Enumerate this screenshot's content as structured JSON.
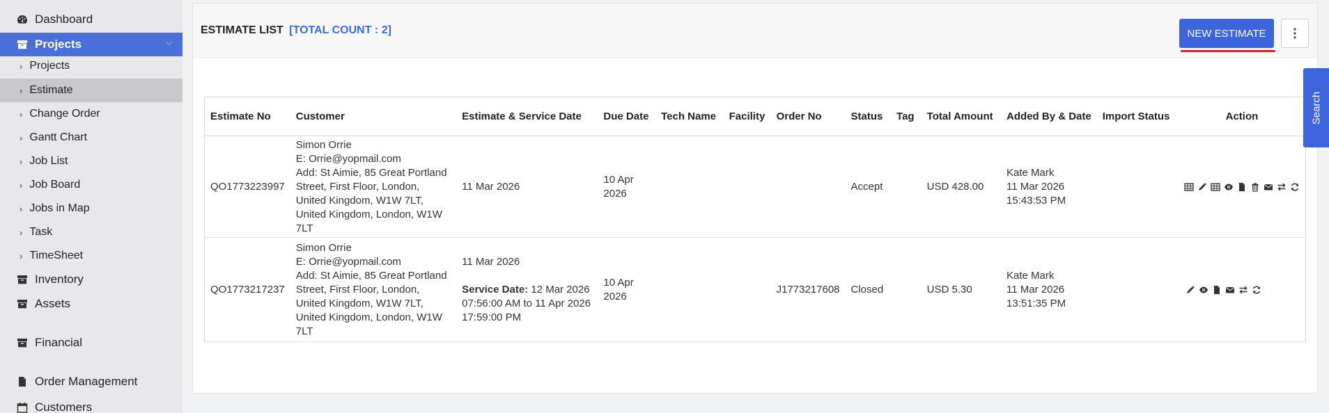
{
  "sidebar": {
    "dashboard": "Dashboard",
    "projects": "Projects",
    "sub_items": [
      "Projects",
      "Estimate",
      "Change Order",
      "Gantt Chart",
      "Job List",
      "Job Board",
      "Jobs in Map",
      "Task",
      "TimeSheet"
    ],
    "inventory": "Inventory",
    "assets": "Assets",
    "financial": "Financial",
    "order_management": "Order Management",
    "customers": "Customers"
  },
  "header": {
    "title": "ESTIMATE LIST",
    "count": "[TOTAL COUNT : 2]",
    "new_button": "NEW ESTIMATE"
  },
  "search_tab": "Search",
  "table": {
    "columns": [
      "Estimate No",
      "Customer",
      "Estimate & Service Date",
      "Due Date",
      "Tech Name",
      "Facility",
      "Order No",
      "Status",
      "Tag",
      "Total Amount",
      "Added By & Date",
      "Import Status",
      "Action"
    ],
    "rows": [
      {
        "estimate_no": "QO1773223997",
        "customer_name": "Simon Orrie",
        "customer_email": "E: Orrie@yopmail.com",
        "customer_address": "Add: St Aimie, 85 Great Portland Street, First Floor, London, United Kingdom, W1W 7LT, United Kingdom, London, W1W 7LT",
        "estimate_date": "11 Mar 2026",
        "due_date": "10 Apr 2026",
        "order_no": "",
        "status": "Accept",
        "total": "USD 428.00",
        "added_by": "Kate Mark",
        "added_date": "11 Mar 2026",
        "added_time": "15:43:53 PM"
      },
      {
        "estimate_no": "QO1773217237",
        "customer_name": "Simon Orrie",
        "customer_email": "E: Orrie@yopmail.com",
        "customer_address": "Add: St Aimie, 85 Great Portland Street, First Floor, London, United Kingdom, W1W 7LT, United Kingdom, London, W1W 7LT",
        "estimate_date": "11 Mar 2026",
        "service_label": "Service Date:",
        "service_range": "12 Mar 2026 07:56:00 AM to 11 Apr 2026 17:59:00 PM",
        "due_date": "10 Apr 2026",
        "order_no": "J1773217608",
        "status": "Closed",
        "total": "USD 5.30",
        "added_by": "Kate Mark",
        "added_date": "11 Mar 2026",
        "added_time": "13:51:35 PM"
      }
    ]
  },
  "colors": {
    "accent": "#3d63dd",
    "sidebar_active": "#4a6fd8",
    "underline": "#e02020"
  }
}
